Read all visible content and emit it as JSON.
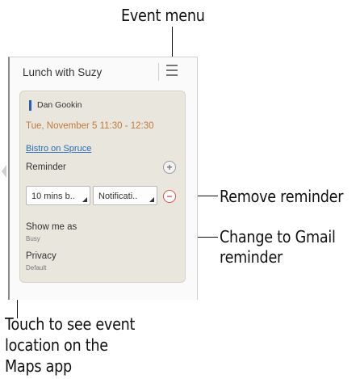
{
  "callouts": {
    "event_menu": "Event menu",
    "remove_reminder": "Remove reminder",
    "change_gmail_line1": "Change to Gmail",
    "change_gmail_line2": "reminder",
    "touch_line1": "Touch to see event",
    "touch_line2": "location on the",
    "touch_line3": "Maps app"
  },
  "event": {
    "title": "Lunch with Suzy",
    "owner": "Dan Gookin",
    "datetime": "Tue, November 5 11:30 - 12:30",
    "location": "Bistro on Spruce",
    "reminder_label": "Reminder",
    "reminder_time": "10 mins b..",
    "reminder_type": "Notificati..",
    "show_me_as_label": "Show me as",
    "show_me_as_value": "Busy",
    "privacy_label": "Privacy",
    "privacy_value": "Default"
  },
  "icons": {
    "menu": "menu-icon",
    "add": "plus-circle-icon",
    "remove": "minus-circle-icon"
  },
  "colors": {
    "owner_accent": "#2a5fb0",
    "datetime": "#c07b3c",
    "link": "#2a6db5",
    "remove": "#d9534f"
  }
}
